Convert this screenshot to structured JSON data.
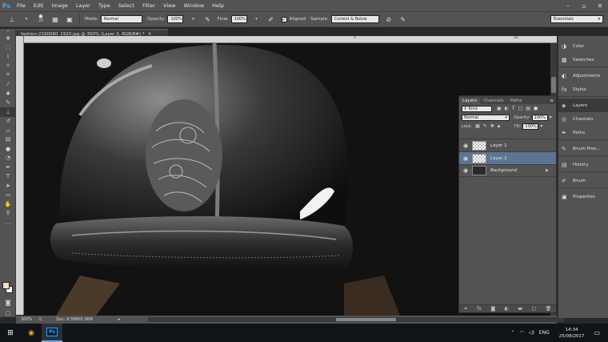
{
  "app": {
    "logo": "Ps"
  },
  "menu": [
    "File",
    "Edit",
    "Image",
    "Layer",
    "Type",
    "Select",
    "Filter",
    "View",
    "Window",
    "Help"
  ],
  "options": {
    "brush_size": "20",
    "mode_label": "Mode:",
    "mode_value": "Normal",
    "opacity_label": "Opacity:",
    "opacity_value": "100%",
    "flow_label": "Flow:",
    "flow_value": "100%",
    "aligned_label": "Aligned",
    "sample_label": "Sample:",
    "sample_value": "Current & Below",
    "workspace": "Essentials"
  },
  "document": {
    "tab_title": "fashion-2190060_1920.jpg @ 300% (Layer 2, RGB/8#) *",
    "ruler_ticks": [
      "5",
      "10"
    ],
    "zoom": "300%",
    "doc_size": "Doc: 6.59M/0.36M"
  },
  "layers_panel": {
    "tabs": [
      "Layers",
      "Channels",
      "Paths"
    ],
    "filter_kind": "Kind",
    "blend_mode": "Normal",
    "opacity_label": "Opacity:",
    "opacity_value": "100%",
    "lock_label": "Lock:",
    "fill_label": "Fill:",
    "fill_value": "100%",
    "layers": [
      {
        "name": "Layer 1",
        "selected": false,
        "type": "transparent"
      },
      {
        "name": "Layer 2",
        "selected": true,
        "type": "transparent"
      },
      {
        "name": "Background",
        "selected": false,
        "type": "photo"
      }
    ]
  },
  "dock": {
    "groups": [
      [
        "Color",
        "Swatches"
      ],
      [
        "Adjustments",
        "Styles"
      ],
      [
        "Layers",
        "Channels",
        "Paths"
      ],
      [
        "Brush Pres..."
      ],
      [
        "History"
      ],
      [
        "Brush"
      ],
      [
        "Properties"
      ]
    ]
  },
  "taskbar": {
    "language": "ENG",
    "time": "14:34",
    "date": "25/08/2017"
  }
}
